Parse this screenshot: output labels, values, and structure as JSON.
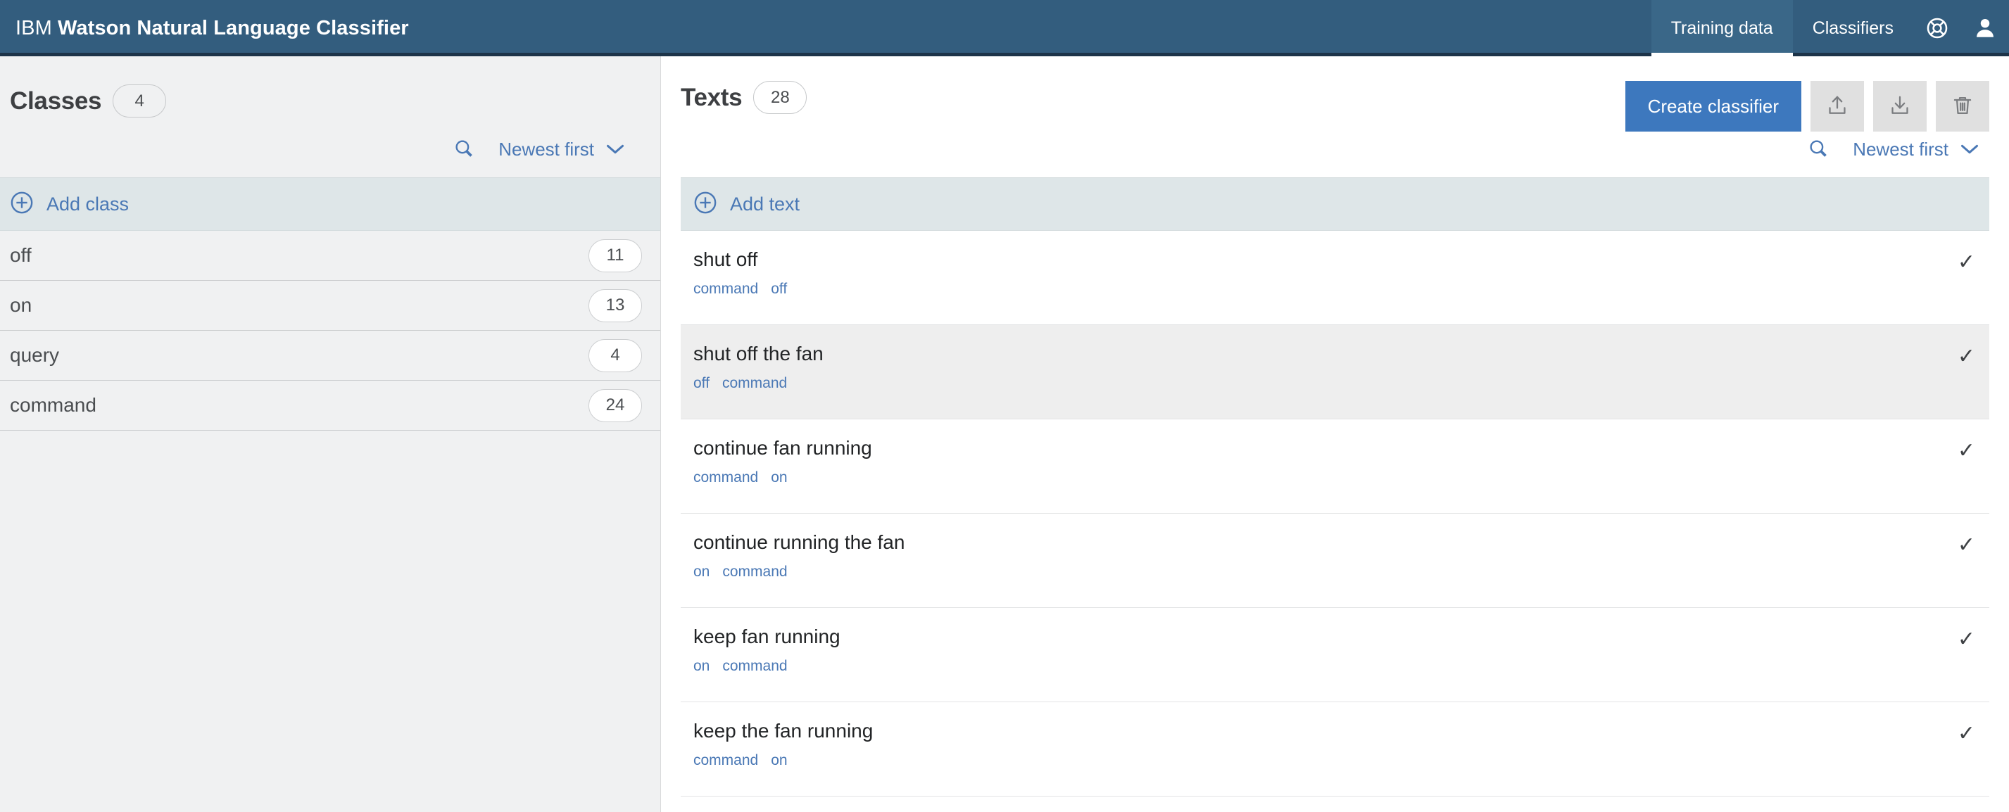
{
  "header": {
    "brand_light": "IBM",
    "brand_bold": "Watson Natural Language Classifier",
    "tabs": [
      {
        "label": "Training data",
        "active": true
      },
      {
        "label": "Classifiers",
        "active": false
      }
    ],
    "help_icon": "lifebuoy-icon",
    "account_icon": "user-avatar-icon",
    "bg_color": "#335d7e",
    "active_tab_bg": "#3a6788",
    "underline_color": "#1d3449"
  },
  "classes_panel": {
    "title": "Classes",
    "count": "4",
    "search_icon": "search-icon",
    "sort_label": "Newest first",
    "sort_chevron": "chevron-down-icon",
    "add_label": "Add class",
    "add_icon": "plus-circle-icon",
    "items": [
      {
        "name": "off",
        "count": "11"
      },
      {
        "name": "on",
        "count": "13"
      },
      {
        "name": "query",
        "count": "4"
      },
      {
        "name": "command",
        "count": "24"
      }
    ]
  },
  "texts_panel": {
    "title": "Texts",
    "count": "28",
    "create_classifier_label": "Create classifier",
    "upload_icon": "upload-icon",
    "download_icon": "download-icon",
    "delete_icon": "trash-icon",
    "search_icon": "search-icon",
    "sort_label": "Newest first",
    "sort_chevron": "chevron-down-icon",
    "add_label": "Add text",
    "add_icon": "plus-circle-icon",
    "check_glyph": "✓",
    "rows": [
      {
        "text": "shut off",
        "tags": [
          "command",
          "off"
        ],
        "hovered": false
      },
      {
        "text": "shut off the fan",
        "tags": [
          "off",
          "command"
        ],
        "hovered": true
      },
      {
        "text": "continue fan running",
        "tags": [
          "command",
          "on"
        ],
        "hovered": false
      },
      {
        "text": "continue running the fan",
        "tags": [
          "on",
          "command"
        ],
        "hovered": false
      },
      {
        "text": "keep fan running",
        "tags": [
          "on",
          "command"
        ],
        "hovered": false
      },
      {
        "text": "keep the fan running",
        "tags": [
          "command",
          "on"
        ],
        "hovered": false
      }
    ]
  },
  "colors": {
    "accent_blue": "#4a78b5",
    "primary_button": "#3d78be",
    "panel_bg": "#f0f1f2",
    "add_row_bg": "#dee6e8",
    "hover_row": "#eeeeee"
  }
}
